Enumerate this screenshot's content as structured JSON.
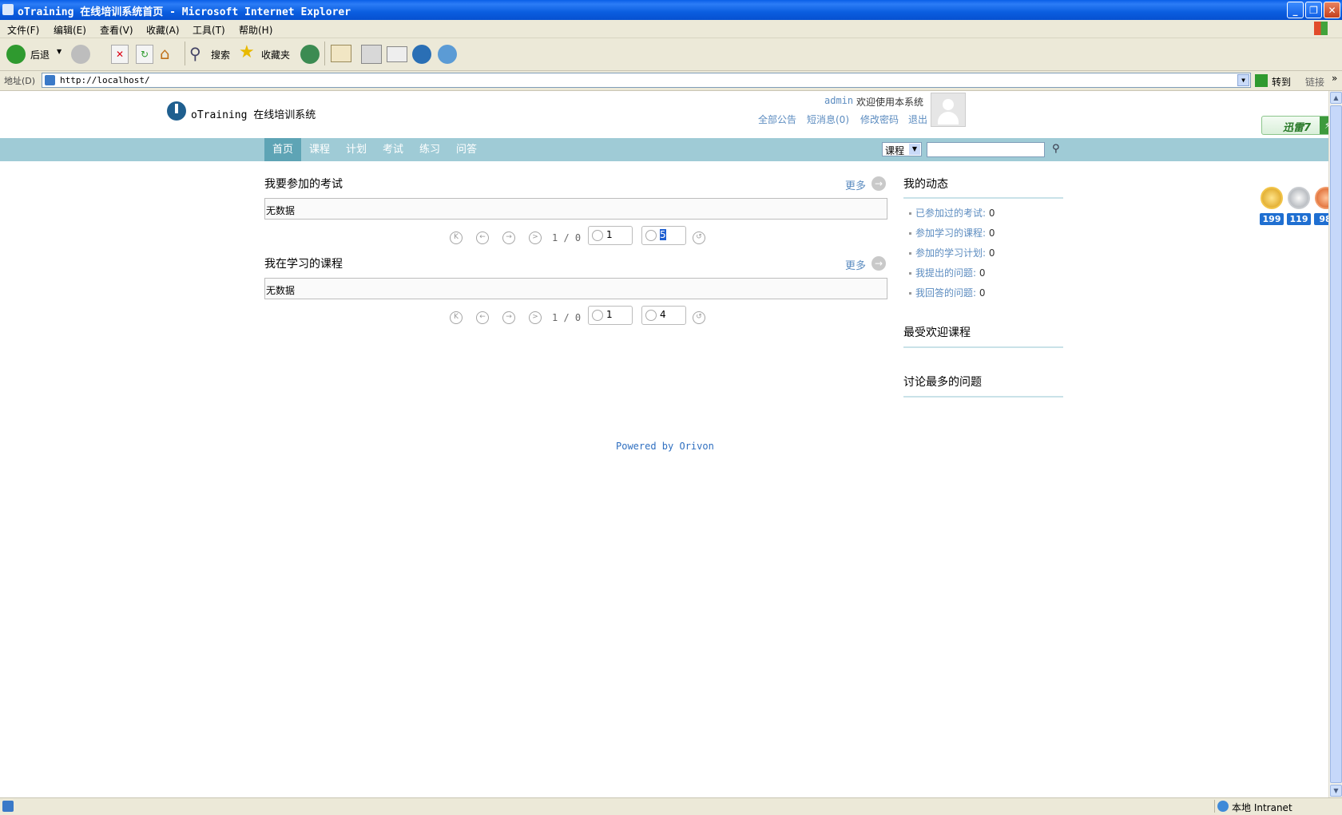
{
  "window": {
    "title": "oTraining 在线培训系统首页 - Microsoft Internet Explorer",
    "minimize": "_",
    "maximize": "❐",
    "close": "✕"
  },
  "menubar": {
    "items": [
      "文件(F)",
      "编辑(E)",
      "查看(V)",
      "收藏(A)",
      "工具(T)",
      "帮助(H)"
    ]
  },
  "toolbar": {
    "back": "后退",
    "search": "搜索",
    "favorites": "收藏夹"
  },
  "address": {
    "label": "地址(D)",
    "url": "http://localhost/",
    "go": "转到",
    "links": "链接"
  },
  "header": {
    "logo_text": "oTraining 在线培训系统",
    "user": "admin",
    "welcome": "欢迎使用本系统",
    "links": [
      "全部公告",
      "短消息(0)",
      "修改密码",
      "退出"
    ]
  },
  "nav": {
    "items": [
      "首页",
      "课程",
      "计划",
      "考试",
      "练习",
      "问答"
    ],
    "search_select": "课程",
    "search_value": ""
  },
  "exams": {
    "title": "我要参加的考试",
    "more": "更多",
    "empty": "无数据",
    "page_info": "1 / 0",
    "page_input": "1",
    "size_input": "5"
  },
  "courses": {
    "title": "我在学习的课程",
    "more": "更多",
    "empty": "无数据",
    "page_info": "1 / 0",
    "page_input": "1",
    "size_input": "4"
  },
  "sidebar": {
    "activity_title": "我的动态",
    "activities": [
      {
        "label": "已参加过的考试:",
        "count": "0"
      },
      {
        "label": "参加学习的课程:",
        "count": "0"
      },
      {
        "label": "参加的学习计划:",
        "count": "0"
      },
      {
        "label": "我提出的问题:",
        "count": "0"
      },
      {
        "label": "我回答的问题:",
        "count": "0"
      }
    ],
    "popular_title": "最受欢迎课程",
    "discussed_title": "讨论最多的问题"
  },
  "footer": {
    "powered": "Powered by Orivon"
  },
  "overlay": {
    "xunlei": "迅雷7",
    "medals": [
      "199",
      "119",
      "98"
    ]
  },
  "statusbar": {
    "zone": "本地 Intranet"
  }
}
